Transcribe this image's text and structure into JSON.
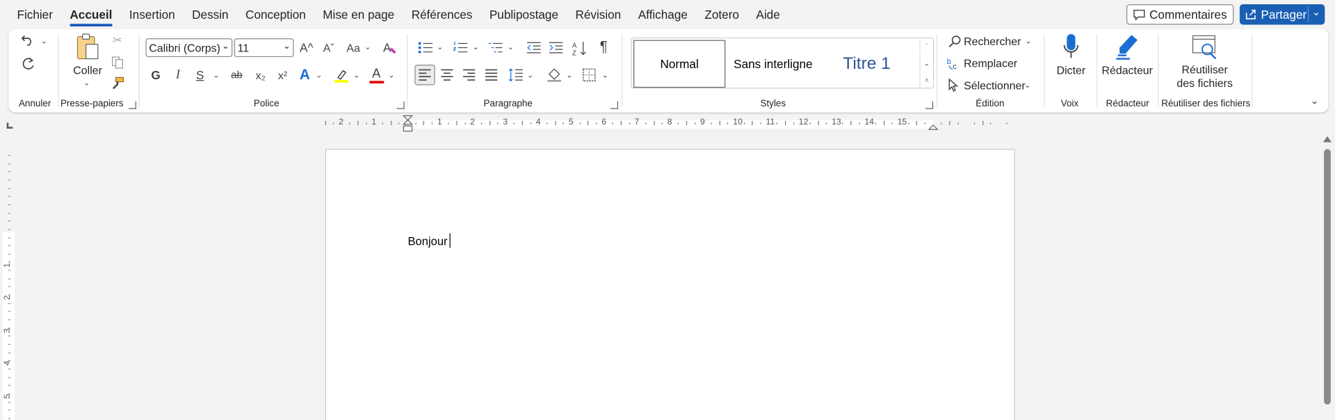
{
  "menu": {
    "tabs": [
      "Fichier",
      "Accueil",
      "Insertion",
      "Dessin",
      "Conception",
      "Mise en page",
      "Références",
      "Publipostage",
      "Révision",
      "Affichage",
      "Zotero",
      "Aide"
    ],
    "active": "Accueil",
    "comments_label": "Commentaires",
    "share_label": "Partager"
  },
  "ribbon": {
    "groups": {
      "annuler": "Annuler",
      "presse_papiers": "Presse-papiers",
      "police": "Police",
      "paragraphe": "Paragraphe",
      "styles": "Styles",
      "edition": "Édition",
      "voix": "Voix",
      "redacteur": "Rédacteur",
      "reutiliser": "Réutiliser des fichiers"
    },
    "paste_label": "Coller",
    "font_name": "Calibri (Corps)",
    "font_size": "11",
    "bold_glyph": "G",
    "italic_glyph": "I",
    "underline_glyph": "S",
    "strike_glyph": "ab",
    "subscript_glyph": "x₂",
    "superscript_glyph": "x²",
    "grow_glyph": "A^",
    "shrink_glyph": "Aˇ",
    "case_glyph": "Aa",
    "text_effect_glyph": "A",
    "font_color_glyph": "A",
    "pilcrow": "¶",
    "styles": [
      "Normal",
      "Sans interligne",
      "Titre 1"
    ],
    "rechercher": "Rechercher",
    "remplacer": "Remplacer",
    "selectionner": "Sélectionner",
    "dicter": "Dicter",
    "redacteur_btn": "Rédacteur",
    "reutiliser_line1": "Réutiliser",
    "reutiliser_line2": "des fichiers",
    "colors": {
      "accent": "#185abd",
      "share_bg": "#1a5fb4",
      "highlight": "#ffff00",
      "font_color": "#e00000",
      "titre": "#2f5496"
    }
  },
  "ruler": {
    "numbers": [
      "2",
      "1",
      "1",
      "2",
      "3",
      "4",
      "5",
      "6",
      "7",
      "8",
      "9",
      "10",
      "11",
      "12",
      "13",
      "14",
      "15"
    ],
    "vnumbers": [
      "1",
      "2",
      "3",
      "4",
      "5"
    ]
  },
  "document": {
    "text": "Bonjour"
  }
}
